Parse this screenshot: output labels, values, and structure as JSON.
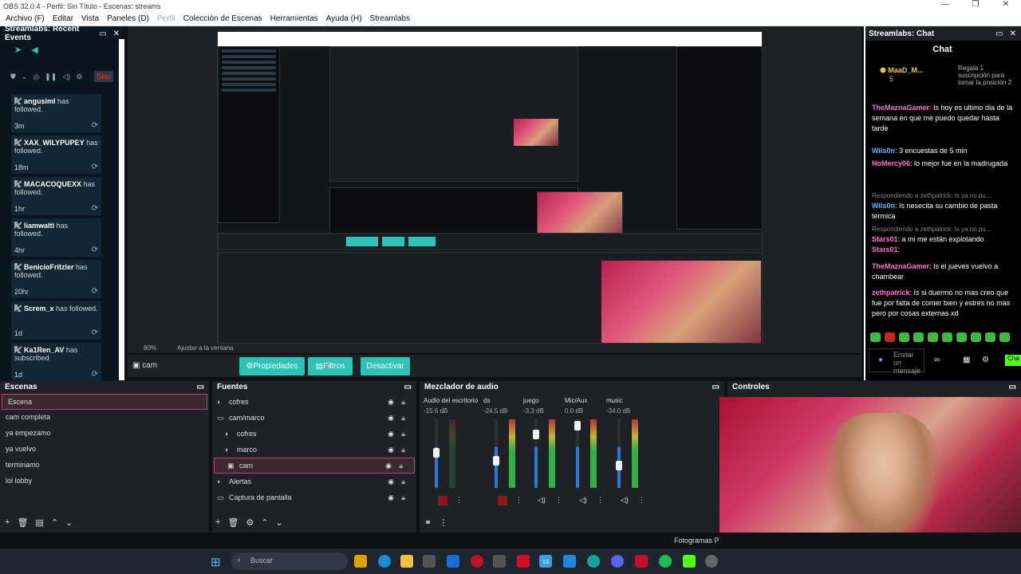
{
  "window": {
    "title": "OBS 32.0.4 - Perfil: Sin Título - Escenas: streams",
    "controls": [
      "—",
      "❐",
      "✕"
    ]
  },
  "menu": [
    "Archivo (F)",
    "Editar",
    "Vista",
    "Paneles (D)",
    "Perfil",
    "Colección de Escenas",
    "Herramientas",
    "Ayuda (H)",
    "Streamlabs"
  ],
  "events": {
    "title": "Streamlabs: Recent Events",
    "skip": "Skip",
    "items": [
      {
        "name": "angusiml",
        "action": "has followed.",
        "time": "3m"
      },
      {
        "name": "XAX_WILYPUPEY",
        "action": "has followed.",
        "time": "18m"
      },
      {
        "name": "MACACOQUEXX",
        "action": "has followed.",
        "time": "1hr"
      },
      {
        "name": "liamwalti",
        "action": "has followed.",
        "time": "4hr"
      },
      {
        "name": "BenicioFritzler",
        "action": "has followed.",
        "time": "20hr"
      },
      {
        "name": "Screm_x",
        "action": "has followed.",
        "time": "1d"
      },
      {
        "name": "Ka1Ren_AV",
        "action": "has subscribed",
        "time": "1d"
      }
    ]
  },
  "preview": {
    "zoom": "80%",
    "fit": "Ajustar a la ventana"
  },
  "source_bar": {
    "current": "cam",
    "props": "Propiedades",
    "filters": "Filtros",
    "deactivate": "Desactivar"
  },
  "chat": {
    "panel_title": "Streamlabs: Chat",
    "header": "Chat",
    "pinned_user": "MaaD_M...",
    "pinned_count": "5",
    "pinned_text": "Regala 1 suscripción para tomar la posición 2",
    "messages": [
      {
        "user": "TheMaznaGamer",
        "text": ": Is hoy es ultimo dia de la semana en que me puedo quedar hasta tarde",
        "cls": "u1"
      },
      {
        "user": "Wils0n",
        "text": ": 3 encuestas de 5 min",
        "cls": "u2"
      },
      {
        "user": "NoMercy06",
        "text": ": lo mejor fue en la madrugada",
        "cls": "u1"
      },
      {
        "user": "Wils0n",
        "text": ": Is nesecita su cambio de pasta termica",
        "cls": "u2",
        "reply": "Respondiendo a zethpatrick: Is ya no pu..."
      },
      {
        "user": "Stars01",
        "text": ": a mi me están explotando",
        "cls": "u1",
        "reply": "Respondiendo a zethpatrick: Is ya no pu..."
      },
      {
        "user": "Stars01",
        "text": ":",
        "cls": "u1"
      },
      {
        "user": "TheMaznaGamer",
        "text": ": Is el jueves vuelvo a chambear",
        "cls": "u1"
      },
      {
        "user": "zethpatrick",
        "text": ": Is si duermo no mas creo que fue por falta de comer bien y estres no mas pero por cosas externas xd",
        "cls": "u1"
      }
    ],
    "input_placeholder": "Enviar un mensaje",
    "send": "Cha"
  },
  "scenes": {
    "title": "Escenas",
    "items": [
      "Escena",
      "cam completa",
      "ya empezamo",
      "ya vuelvo",
      "terminamo",
      "lol lobby"
    ],
    "selected": 0
  },
  "sources": {
    "title": "Fuentes",
    "items": [
      {
        "name": "cofres",
        "icon": "◐",
        "indent": 0
      },
      {
        "name": "cam/marco",
        "icon": "▭",
        "indent": 0
      },
      {
        "name": "cofres",
        "icon": "◐",
        "indent": 1
      },
      {
        "name": "marco",
        "icon": "◐",
        "indent": 1
      },
      {
        "name": "cam",
        "icon": "▣",
        "indent": 1
      },
      {
        "name": "Alertas",
        "icon": "◐",
        "indent": 0
      },
      {
        "name": "Captura de pantalla",
        "icon": "▭",
        "indent": 0
      }
    ],
    "selected": 4
  },
  "mixer": {
    "title": "Mezclador de audio",
    "channels": [
      {
        "name": "Audio del escritorio",
        "db": "-15.6 dB"
      },
      {
        "name": "ds",
        "db": "-24.5 dB"
      },
      {
        "name": "juego",
        "db": "-3.3 dB"
      },
      {
        "name": "Mic/Aux",
        "db": "0.0 dB"
      },
      {
        "name": "music",
        "db": "-34.0 dB"
      }
    ],
    "scale": [
      "5",
      "0",
      "-5",
      "-10",
      "-15",
      "-20",
      "-25",
      "-30",
      "-35",
      "-40",
      "-45",
      "-50",
      "-55",
      "-60"
    ]
  },
  "controls": {
    "title": "Controles",
    "stats_label": "Fotogramas P"
  },
  "taskbar": {
    "search": "Buscar",
    "badge": "13"
  }
}
